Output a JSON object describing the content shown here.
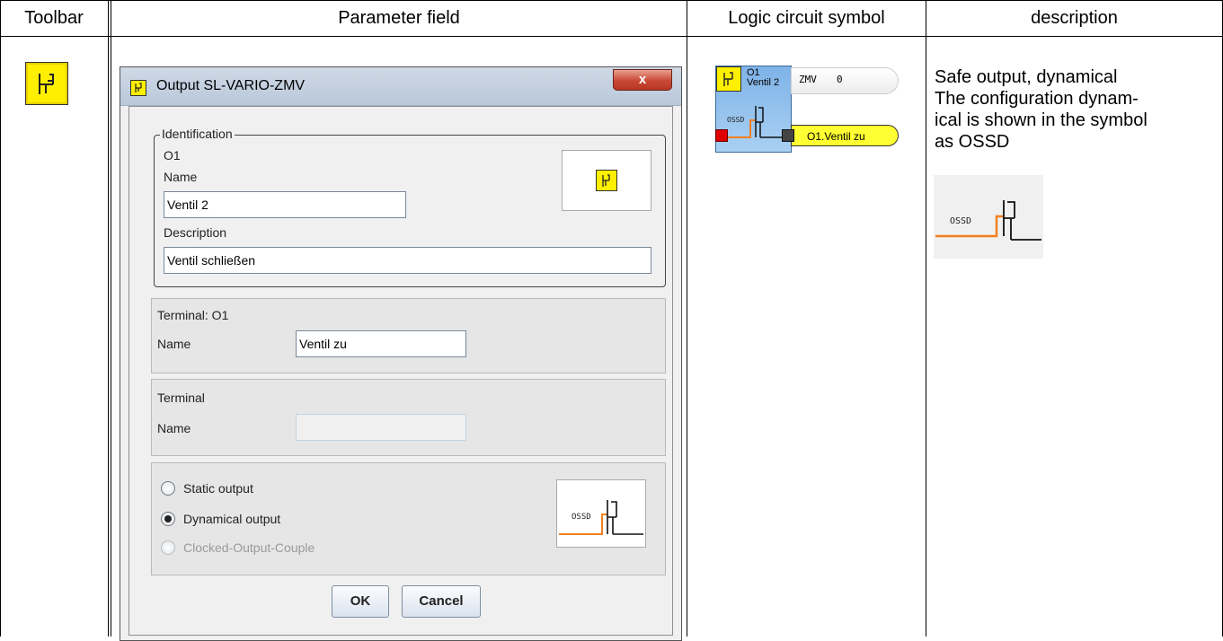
{
  "table": {
    "headers": [
      "Toolbar",
      "Parameter field",
      "Logic circuit symbol",
      "description"
    ]
  },
  "toolbar": {
    "icon": "output-switch-icon",
    "icon_color": "#ffef00"
  },
  "dialog": {
    "title": "Output SL-VARIO-ZMV",
    "close_symbol": "x",
    "identification": {
      "legend": "Identification",
      "id": "O1",
      "name_label": "Name",
      "name_value": "Ventil 2",
      "description_label": "Description",
      "description_value": "Ventil schließen"
    },
    "terminal_o1": {
      "title": "Terminal: O1",
      "name_label": "Name",
      "name_value": "Ventil zu"
    },
    "terminal": {
      "title": "Terminal",
      "name_label": "Name",
      "name_value": ""
    },
    "output_mode": {
      "options": [
        {
          "label": "Static output",
          "checked": false,
          "enabled": true
        },
        {
          "label": "Dynamical output",
          "checked": true,
          "enabled": true
        },
        {
          "label": "Clocked-Output-Couple",
          "checked": false,
          "enabled": false
        }
      ],
      "ossd_label": "OSSD"
    },
    "ok_label": "OK",
    "cancel_label": "Cancel"
  },
  "symbol": {
    "id": "O1",
    "name": "Ventil 2",
    "zmv_label": "ZMV",
    "zmv_value": "0",
    "ossd_label": "OSSD",
    "output_label": "O1.Ventil zu",
    "colors": {
      "block": "#a9d0f2",
      "yellow": "#ffff33",
      "red": "#e00000",
      "orange": "#f08020"
    }
  },
  "description": {
    "lines": [
      "Safe output, dynamical",
      "The configuration dynam-",
      "ical is shown in the symbol",
      "as OSSD"
    ],
    "ossd_label": "OSSD"
  }
}
